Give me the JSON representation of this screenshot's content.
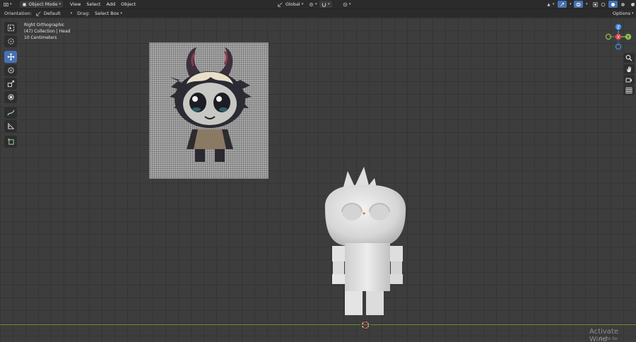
{
  "header": {
    "mode": "Object Mode",
    "menus": [
      "View",
      "Select",
      "Add",
      "Object"
    ],
    "orientation_label": "Orientation:",
    "orientation_value": "Default",
    "drag_label": "Drag:",
    "drag_value": "Select Box",
    "transform_space": "Global",
    "options_label": "Options"
  },
  "viewport_info": {
    "view_name": "Right Orthographic",
    "collection": "(47) Collection | Head",
    "scale": "10 Centimeters"
  },
  "toolbar": {
    "tools": [
      "select-box",
      "cursor",
      "move",
      "rotate",
      "scale",
      "transform",
      "annotate",
      "measure",
      "add-cube"
    ],
    "active_tool": "move"
  },
  "gizmo": {
    "axes": [
      "Z",
      "Y",
      "X"
    ],
    "colors": {
      "x": "#e5434f",
      "y": "#8bc34a",
      "z": "#3f8ee8"
    }
  },
  "watermark": {
    "line1": "Activate Wind",
    "line2": "Go to Se"
  },
  "colors": {
    "accent": "#4772b3",
    "header_bg": "#2b2b2b",
    "viewport_bg": "#3d3d3d"
  }
}
